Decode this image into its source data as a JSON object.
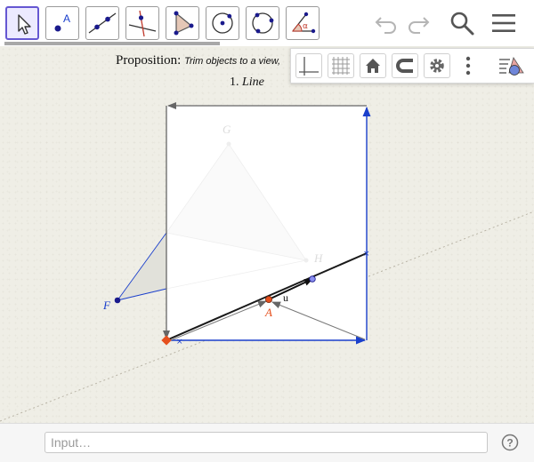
{
  "toolbar": {
    "tools": [
      {
        "name": "move-tool",
        "icon": "cursor-arrow-icon",
        "active": true
      },
      {
        "name": "point-tool",
        "icon": "point-icon",
        "label": "A"
      },
      {
        "name": "line-tool",
        "icon": "line-through-points-icon"
      },
      {
        "name": "perpendicular-line-tool",
        "icon": "perpendicular-line-icon"
      },
      {
        "name": "polygon-tool",
        "icon": "polygon-icon"
      },
      {
        "name": "circle-center-point-tool",
        "icon": "circle-center-icon"
      },
      {
        "name": "circle-three-points-tool",
        "icon": "circle-three-points-icon"
      },
      {
        "name": "angle-tool",
        "icon": "angle-icon",
        "label": "α"
      }
    ],
    "right": [
      "undo-icon",
      "redo-icon",
      "search-icon",
      "menu-icon"
    ]
  },
  "style_bar": {
    "buttons": [
      "axes-toggle-icon",
      "grid-toggle-icon",
      "home-icon",
      "point-capturing-icon",
      "settings-icon",
      "more-icon"
    ],
    "graphics_view_toggle": "graphics-view-icon"
  },
  "canvas": {
    "proposition_label": "Proposition:",
    "proposition_text": "Trim objects to a view,",
    "subtitle_num": "1.",
    "subtitle_word": "Line",
    "labels": {
      "point_F": "F",
      "point_A": "A",
      "vector_u": "u",
      "ghost_G": "G",
      "ghost_H": "H"
    }
  },
  "input_bar": {
    "placeholder": "Input…",
    "value": ""
  },
  "colors": {
    "accent": "#6557d2",
    "blue": "#1a3fcc",
    "dark_blue": "#1a1a8c",
    "orange": "#e5501e",
    "view_frame_gray": "#6a6a6a"
  }
}
